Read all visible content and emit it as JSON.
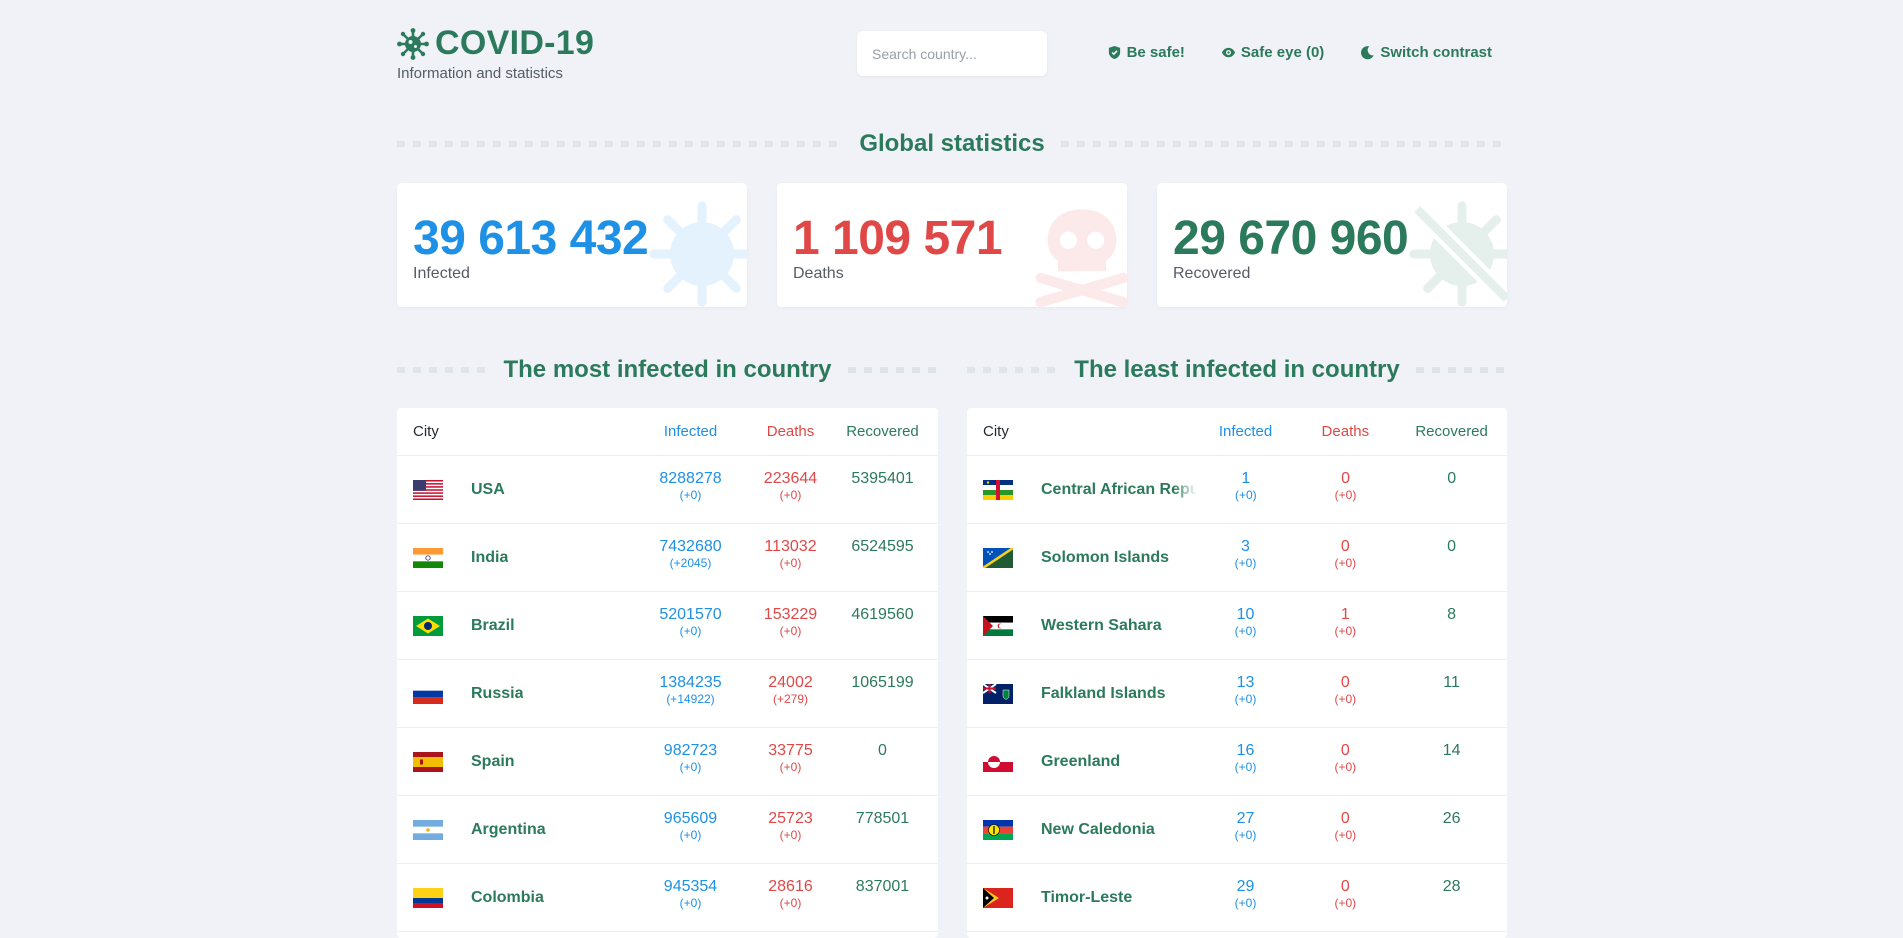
{
  "header": {
    "title": "COVID-19",
    "subtitle": "Information and statistics",
    "search_placeholder": "Search country...",
    "nav": [
      {
        "label": "Be safe!",
        "icon": "shield-icon"
      },
      {
        "label": "Safe eye (0)",
        "icon": "eye-icon"
      },
      {
        "label": "Switch contrast",
        "icon": "moon-icon"
      }
    ]
  },
  "global": {
    "title": "Global statistics",
    "infected": {
      "value": "39 613 432",
      "label": "Infected",
      "color": "#1e90e5",
      "icon": "virus-icon"
    },
    "deaths": {
      "value": "1 109 571",
      "label": "Deaths",
      "color": "#e04848",
      "icon": "skull-icon"
    },
    "recovered": {
      "value": "29 670 960",
      "label": "Recovered",
      "color": "#2c7a5c",
      "icon": "virus-crossed-icon"
    }
  },
  "most": {
    "title": "The most infected in country",
    "headers": {
      "city": "City",
      "infected": "Infected",
      "deaths": "Deaths",
      "recovered": "Recovered"
    },
    "rows": [
      {
        "country": "USA",
        "flag": "flag-usa",
        "infected": "8288278",
        "infected_delta": "(+0)",
        "deaths": "223644",
        "deaths_delta": "(+0)",
        "recovered": "5395401"
      },
      {
        "country": "India",
        "flag": "flag-india",
        "infected": "7432680",
        "infected_delta": "(+2045)",
        "deaths": "113032",
        "deaths_delta": "(+0)",
        "recovered": "6524595"
      },
      {
        "country": "Brazil",
        "flag": "flag-brazil",
        "infected": "5201570",
        "infected_delta": "(+0)",
        "deaths": "153229",
        "deaths_delta": "(+0)",
        "recovered": "4619560"
      },
      {
        "country": "Russia",
        "flag": "flag-russia",
        "infected": "1384235",
        "infected_delta": "(+14922)",
        "deaths": "24002",
        "deaths_delta": "(+279)",
        "recovered": "1065199"
      },
      {
        "country": "Spain",
        "flag": "flag-spain",
        "infected": "982723",
        "infected_delta": "(+0)",
        "deaths": "33775",
        "deaths_delta": "(+0)",
        "recovered": "0"
      },
      {
        "country": "Argentina",
        "flag": "flag-argentina",
        "infected": "965609",
        "infected_delta": "(+0)",
        "deaths": "25723",
        "deaths_delta": "(+0)",
        "recovered": "778501"
      },
      {
        "country": "Colombia",
        "flag": "flag-colombia",
        "infected": "945354",
        "infected_delta": "(+0)",
        "deaths": "28616",
        "deaths_delta": "(+0)",
        "recovered": "837001"
      }
    ]
  },
  "least": {
    "title": "The least infected in country",
    "headers": {
      "city": "City",
      "infected": "Infected",
      "deaths": "Deaths",
      "recovered": "Recovered"
    },
    "rows": [
      {
        "country": "Central African Republic",
        "flag": "flag-car",
        "infected": "1",
        "infected_delta": "(+0)",
        "deaths": "0",
        "deaths_delta": "(+0)",
        "recovered": "0"
      },
      {
        "country": "Solomon Islands",
        "flag": "flag-solomon",
        "infected": "3",
        "infected_delta": "(+0)",
        "deaths": "0",
        "deaths_delta": "(+0)",
        "recovered": "0"
      },
      {
        "country": "Western Sahara",
        "flag": "flag-western-sahara",
        "infected": "10",
        "infected_delta": "(+0)",
        "deaths": "1",
        "deaths_delta": "(+0)",
        "recovered": "8"
      },
      {
        "country": "Falkland Islands",
        "flag": "flag-falkland",
        "infected": "13",
        "infected_delta": "(+0)",
        "deaths": "0",
        "deaths_delta": "(+0)",
        "recovered": "11"
      },
      {
        "country": "Greenland",
        "flag": "flag-greenland",
        "infected": "16",
        "infected_delta": "(+0)",
        "deaths": "0",
        "deaths_delta": "(+0)",
        "recovered": "14"
      },
      {
        "country": "New Caledonia",
        "flag": "flag-new-caledonia",
        "infected": "27",
        "infected_delta": "(+0)",
        "deaths": "0",
        "deaths_delta": "(+0)",
        "recovered": "26"
      },
      {
        "country": "Timor-Leste",
        "flag": "flag-timor-leste",
        "infected": "29",
        "infected_delta": "(+0)",
        "deaths": "0",
        "deaths_delta": "(+0)",
        "recovered": "28"
      }
    ]
  }
}
